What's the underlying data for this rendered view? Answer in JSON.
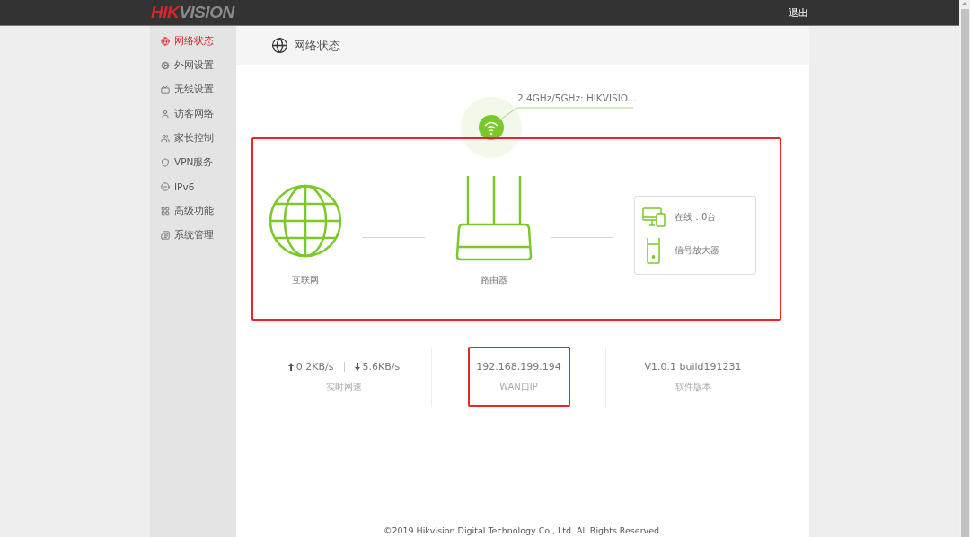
{
  "logo": {
    "accent": "HIK",
    "rest": "VISION"
  },
  "logout": "退出",
  "sidebar": {
    "items": [
      {
        "label": "网络状态",
        "selected": true
      },
      {
        "label": "外网设置",
        "selected": false
      },
      {
        "label": "无线设置",
        "selected": false
      },
      {
        "label": "访客网络",
        "selected": false
      },
      {
        "label": "家长控制",
        "selected": false
      },
      {
        "label": "VPN服务",
        "selected": false
      },
      {
        "label": "IPv6",
        "selected": false
      },
      {
        "label": "高级功能",
        "selected": false
      },
      {
        "label": "系统管理",
        "selected": false
      }
    ]
  },
  "page_title": "网络状态",
  "wifi": {
    "ssid": "2.4GHz/5GHz: HIKVISIO..."
  },
  "topology": {
    "highlighted": true,
    "internet": "互联网",
    "router": "路由器",
    "clients": [
      {
        "kind": "devices",
        "label": "在线：0台"
      },
      {
        "kind": "extender",
        "label": "信号放大器"
      }
    ]
  },
  "stats": [
    {
      "kind": "speed",
      "up": "0.2KB/s",
      "down": "5.6KB/s",
      "label": "实时网速",
      "highlighted": false
    },
    {
      "kind": "text",
      "value": "192.168.199.194",
      "label": "WAN口IP",
      "highlighted": true
    },
    {
      "kind": "text",
      "value": "V1.0.1 build191231",
      "label": "软件版本",
      "highlighted": false
    }
  ],
  "footer": "©2019 Hikvision Digital Technology Co., Ltd. All Rights Reserved."
}
